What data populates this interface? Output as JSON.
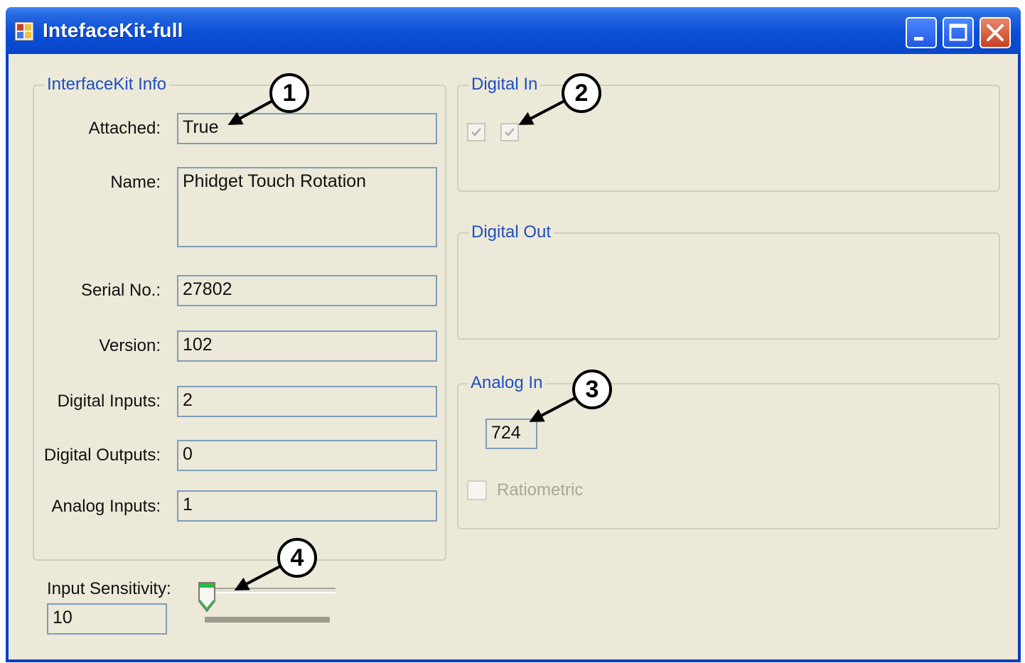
{
  "window": {
    "title": "IntefaceKit-full"
  },
  "info_group": {
    "title": "InterfaceKit Info",
    "fields": [
      {
        "label": "Attached:",
        "value": "True"
      },
      {
        "label": "Name:",
        "value": "Phidget Touch Rotation"
      },
      {
        "label": "Serial No.:",
        "value": "27802"
      },
      {
        "label": "Version:",
        "value": "102"
      },
      {
        "label": "Digital Inputs:",
        "value": "2"
      },
      {
        "label": "Digital Outputs:",
        "value": "0"
      },
      {
        "label": "Analog Inputs:",
        "value": "1"
      }
    ]
  },
  "digital_in": {
    "title": "Digital In",
    "states": [
      true,
      true
    ]
  },
  "digital_out": {
    "title": "Digital Out"
  },
  "analog_in": {
    "title": "Analog In",
    "value": "724",
    "ratiometric_label": "Ratiometric",
    "ratiometric_checked": false
  },
  "sensitivity": {
    "label": "Input Sensitivity:",
    "value": "10",
    "slider_level": 0.0
  },
  "callouts": [
    "1",
    "2",
    "3",
    "4"
  ],
  "colors": {
    "title_bar": "#0a46c8",
    "group_title": "#1f4fbf",
    "client_bg": "#ece9d8",
    "close_button": "#c8401f"
  }
}
